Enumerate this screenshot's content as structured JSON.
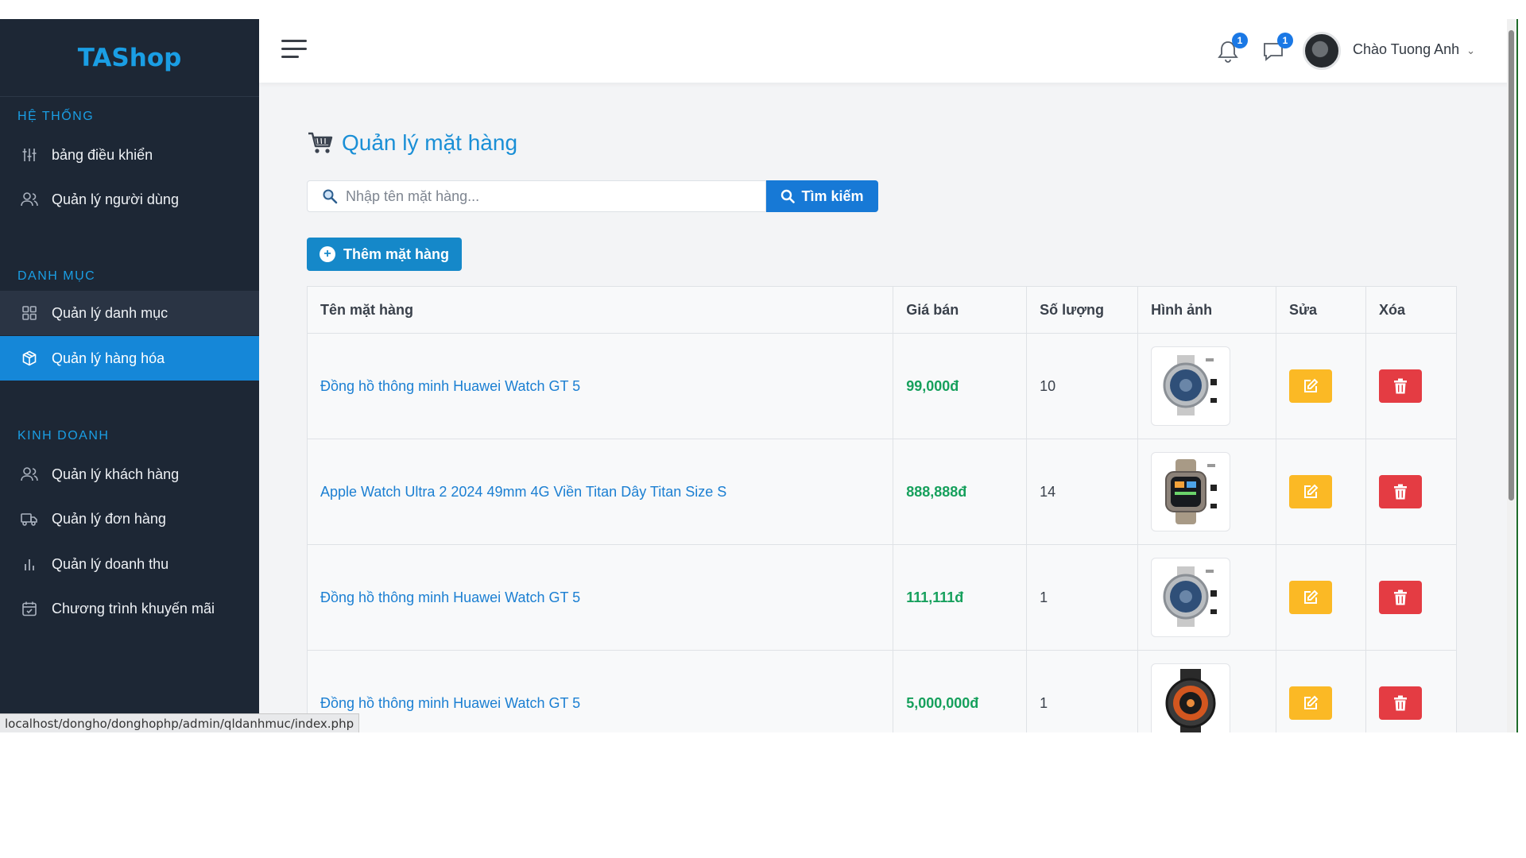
{
  "brand": "TAShop",
  "sidebar": {
    "sections": [
      {
        "title": "HỆ THỐNG",
        "items": [
          {
            "label": "bảng điều khiển",
            "icon": "sliders-icon"
          },
          {
            "label": "Quản lý người dùng",
            "icon": "users-icon"
          }
        ]
      },
      {
        "title": "DANH MỤC",
        "items": [
          {
            "label": "Quản lý danh mục",
            "icon": "grid-icon"
          },
          {
            "label": "Quản lý hàng hóa",
            "icon": "box-icon"
          }
        ]
      },
      {
        "title": "KINH DOANH",
        "items": [
          {
            "label": "Quản lý khách hàng",
            "icon": "users-icon"
          },
          {
            "label": "Quản lý đơn hàng",
            "icon": "truck-icon"
          },
          {
            "label": "Quản lý doanh thu",
            "icon": "bar-chart-icon"
          },
          {
            "label": "Chương trình khuyến mãi",
            "icon": "calendar-icon"
          }
        ]
      }
    ],
    "active_item": "Quản lý hàng hóa",
    "hover_item": "Quản lý danh mục"
  },
  "topbar": {
    "notifications_count": "1",
    "messages_count": "1",
    "greeting": "Chào Tuong Anh"
  },
  "page": {
    "title": "Quản lý mặt hàng",
    "search_placeholder": "Nhập tên mặt hàng...",
    "search_button": "Tìm kiếm",
    "add_button": "Thêm mặt hàng"
  },
  "table": {
    "headers": [
      "Tên mặt hàng",
      "Giá bán",
      "Số lượng",
      "Hình ảnh",
      "Sửa",
      "Xóa"
    ],
    "rows": [
      {
        "name": "Đồng hồ thông minh Huawei Watch GT 5",
        "price": "99,000đ",
        "qty": "10"
      },
      {
        "name": "Apple Watch Ultra 2 2024 49mm 4G Viền Titan Dây Titan Size S",
        "price": "888,888đ",
        "qty": "14"
      },
      {
        "name": "Đồng hồ thông minh Huawei Watch GT 5",
        "price": "111,111đ",
        "qty": "1"
      },
      {
        "name": "Đồng hồ thông minh Huawei Watch GT 5",
        "price": "5,000,000đ",
        "qty": "1"
      }
    ]
  },
  "status_url": "localhost/dongho/donghophp/admin/qldanhmuc/index.php",
  "colors": {
    "sidebar_bg": "#1d2735",
    "accent": "#1a9ee4",
    "active_item": "#1587d8",
    "price": "#16a05c",
    "edit": "#fbb925",
    "delete": "#e43c43"
  }
}
